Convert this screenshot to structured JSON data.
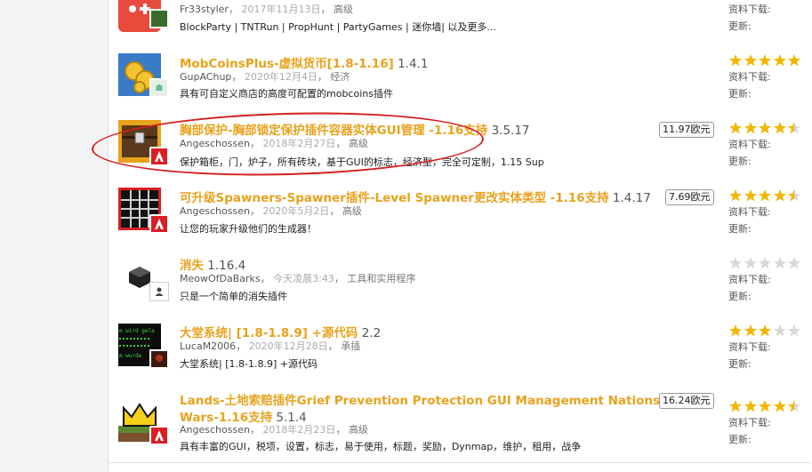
{
  "colors": {
    "title": "#e8a21d",
    "star_filled": "#f2b600",
    "star_empty": "#d8d8d8",
    "annotation": "#d21f1f"
  },
  "labels": {
    "downloads": "资料下载:",
    "updates": "更新:"
  },
  "resources": [
    {
      "author": "Fr33styler",
      "date": "2017年11月13日",
      "category": "高级",
      "description": "BlockParty | TNTRun | PropHunt | PartyGames | 迷你墙| 以及更多...",
      "rating": 0,
      "icon": "game-controller-icon"
    },
    {
      "title": "MobCoinsPlus-虚拟货币[1.8-1.16]",
      "version": "1.4.1",
      "author": "GupAChup",
      "date": "2020年12月4日",
      "category": "经济",
      "description": "具有可自定义商店的高度可配置的mobcoins插件",
      "rating": 5,
      "icon": "gold-coins-icon"
    },
    {
      "title": "胸部保护-胸部锁定保护插件容器实体GUI管理 -1.16支持",
      "version": "3.5.17",
      "author": "Angeschossen",
      "date": "2018年2月27日",
      "category": "高级",
      "description": "保护箱柜，门，炉子，所有砖块，基于GUI的标志，经济型，完全可定制，1.15 Sup",
      "price": "11.97欧元",
      "rating": 4.5,
      "icon": "treasure-chest-icon"
    },
    {
      "title": "可升级Spawners-Spawner插件-Level Spawner更改实体类型 -1.16支持",
      "version": "1.4.17",
      "author": "Angeschossen",
      "date": "2020年5月2日",
      "category": "高级",
      "description": "让您的玩家升级他们的生成器！",
      "price": "7.69欧元",
      "rating": 4.5,
      "icon": "spawner-cage-icon"
    },
    {
      "title": "消失",
      "version": "1.16.4",
      "author": "MeowOfDaBarks",
      "date": "今天凌晨3:43",
      "category": "工具和实用程序",
      "description": "只是一个简单的消失插件",
      "rating": 0,
      "icon": "cube-icon"
    },
    {
      "title": "大堂系统| [1.8-1.8.9] +源代码",
      "version": "2.2",
      "author": "LucaM2006",
      "date": "2020年12月28日",
      "category": "承插",
      "description": "大堂系统| [1.8-1.8.9] +源代码",
      "rating": 3,
      "icon": "terminal-icon",
      "icon_lines": [
        "m wird gela",
        "m wurde"
      ]
    },
    {
      "title": "Lands-土地索赔插件Grief Prevention Protection GUI Management Nations",
      "title2": "Wars-1.16支持",
      "version": "5.1.4",
      "author": "Angeschossen",
      "date": "2018年2月23日",
      "category": "高级",
      "description": "具有丰富的GUI，税项，设置，标志，易于使用，标题，奖励，Dynmap，维护，租用，战争",
      "price": "16.24欧元",
      "rating": 4.5,
      "icon": "crown-icon"
    }
  ]
}
